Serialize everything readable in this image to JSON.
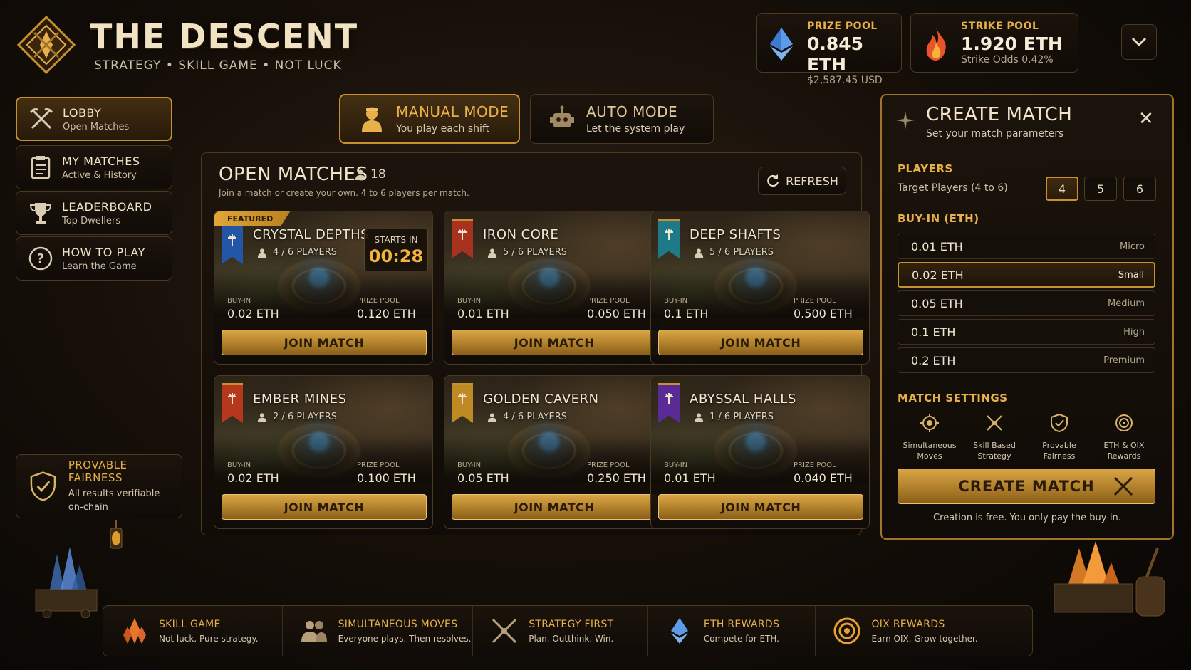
{
  "header": {
    "title": "THE DESCENT",
    "tagline": "STRATEGY • SKILL GAME • NOT LUCK"
  },
  "pools": [
    {
      "label": "PRIZE POOL",
      "value": "0.845 ETH",
      "sub": "$2,587.45 USD",
      "icon": "eth-crystal-icon"
    },
    {
      "label": "STRIKE POOL",
      "value": "1.920 ETH",
      "sub": "Strike Odds 0.42%",
      "icon": "flame-icon"
    }
  ],
  "sidebar": {
    "items": [
      {
        "title": "LOBBY",
        "sub": "Open Matches",
        "icon": "crossed-pickaxes-icon"
      },
      {
        "title": "MY MATCHES",
        "sub": "Active & History",
        "icon": "clipboard-icon"
      },
      {
        "title": "LEADERBOARD",
        "sub": "Top Dwellers",
        "icon": "trophy-icon"
      },
      {
        "title": "HOW TO PLAY",
        "sub": "Learn the Game",
        "icon": "question-icon"
      }
    ],
    "fairness": {
      "title": "PROVABLE FAIRNESS",
      "line1": "All results verifiable",
      "line2": "on-chain"
    }
  },
  "modes": [
    {
      "title": "MANUAL MODE",
      "sub": "You play each shift",
      "icon": "miner-icon",
      "active": true
    },
    {
      "title": "AUTO MODE",
      "sub": "Let the system play",
      "icon": "robot-icon",
      "active": false
    }
  ],
  "open_matches": {
    "title": "OPEN MATCHES",
    "count": "18",
    "subtitle": "Join a match or create your own. 4 to 6 players per match.",
    "refresh_label": "REFRESH",
    "buyin_label": "BUY-IN",
    "prize_label": "PRIZE POOL",
    "join_label": "JOIN MATCH",
    "featured_label": "FEATURED",
    "starts_label": "STARTS IN",
    "starts_time": "00:28",
    "cards": [
      {
        "name": "CRYSTAL DEPTHS",
        "players": "4 / 6 PLAYERS",
        "buyin": "0.02 ETH",
        "prize": "0.120 ETH",
        "banner": "#2456a8"
      },
      {
        "name": "IRON CORE",
        "players": "5 / 6 PLAYERS",
        "buyin": "0.01 ETH",
        "prize": "0.050 ETH",
        "banner": "#a8321e"
      },
      {
        "name": "DEEP SHAFTS",
        "players": "5 / 6 PLAYERS",
        "buyin": "0.1 ETH",
        "prize": "0.500 ETH",
        "banner": "#1e7a88"
      },
      {
        "name": "EMBER MINES",
        "players": "2 / 6 PLAYERS",
        "buyin": "0.02 ETH",
        "prize": "0.100 ETH",
        "banner": "#b5381c"
      },
      {
        "name": "GOLDEN CAVERN",
        "players": "4 / 6 PLAYERS",
        "buyin": "0.05 ETH",
        "prize": "0.250 ETH",
        "banner": "#c08a22"
      },
      {
        "name": "ABYSSAL HALLS",
        "players": "1 / 6 PLAYERS",
        "buyin": "0.01 ETH",
        "prize": "0.040 ETH",
        "banner": "#5a2a96"
      }
    ]
  },
  "create_match": {
    "title": "CREATE MATCH",
    "subtitle": "Set your match parameters",
    "players_label": "PLAYERS",
    "players_hint": "Target Players (4 to 6)",
    "player_options": [
      "4",
      "5",
      "6"
    ],
    "selected_players": "4",
    "buyin_label": "BUY-IN (ETH)",
    "buyins": [
      {
        "value": "0.01 ETH",
        "tier": "Micro"
      },
      {
        "value": "0.02 ETH",
        "tier": "Small"
      },
      {
        "value": "0.05 ETH",
        "tier": "Medium"
      },
      {
        "value": "0.1 ETH",
        "tier": "High"
      },
      {
        "value": "0.2 ETH",
        "tier": "Premium"
      }
    ],
    "selected_buyin": "0.02 ETH",
    "settings_label": "MATCH SETTINGS",
    "settings": [
      {
        "l1": "Simultaneous",
        "l2": "Moves",
        "icon": "gear-icon"
      },
      {
        "l1": "Skill Based",
        "l2": "Strategy",
        "icon": "crossed-swords-icon"
      },
      {
        "l1": "Provable",
        "l2": "Fairness",
        "icon": "shield-icon"
      },
      {
        "l1": "ETH & OIX",
        "l2": "Rewards",
        "icon": "coin-icon"
      }
    ],
    "button_label": "CREATE MATCH",
    "note": "Creation is free. You only pay the buy-in."
  },
  "footer": [
    {
      "title": "SKILL GAME",
      "sub": "Not luck. Pure strategy.",
      "icon": "crystal-icon"
    },
    {
      "title": "SIMULTANEOUS MOVES",
      "sub": "Everyone plays. Then resolves.",
      "icon": "players-icon"
    },
    {
      "title": "STRATEGY FIRST",
      "sub": "Plan. Outthink. Win.",
      "icon": "crossed-swords-icon"
    },
    {
      "title": "ETH REWARDS",
      "sub": "Compete for ETH.",
      "icon": "eth-icon"
    },
    {
      "title": "OIX REWARDS",
      "sub": "Earn OIX. Grow together.",
      "icon": "oix-coin-icon"
    }
  ],
  "colors": {
    "accent": "#e8b04a",
    "border": "#c8902e",
    "bg": "#140e08"
  }
}
